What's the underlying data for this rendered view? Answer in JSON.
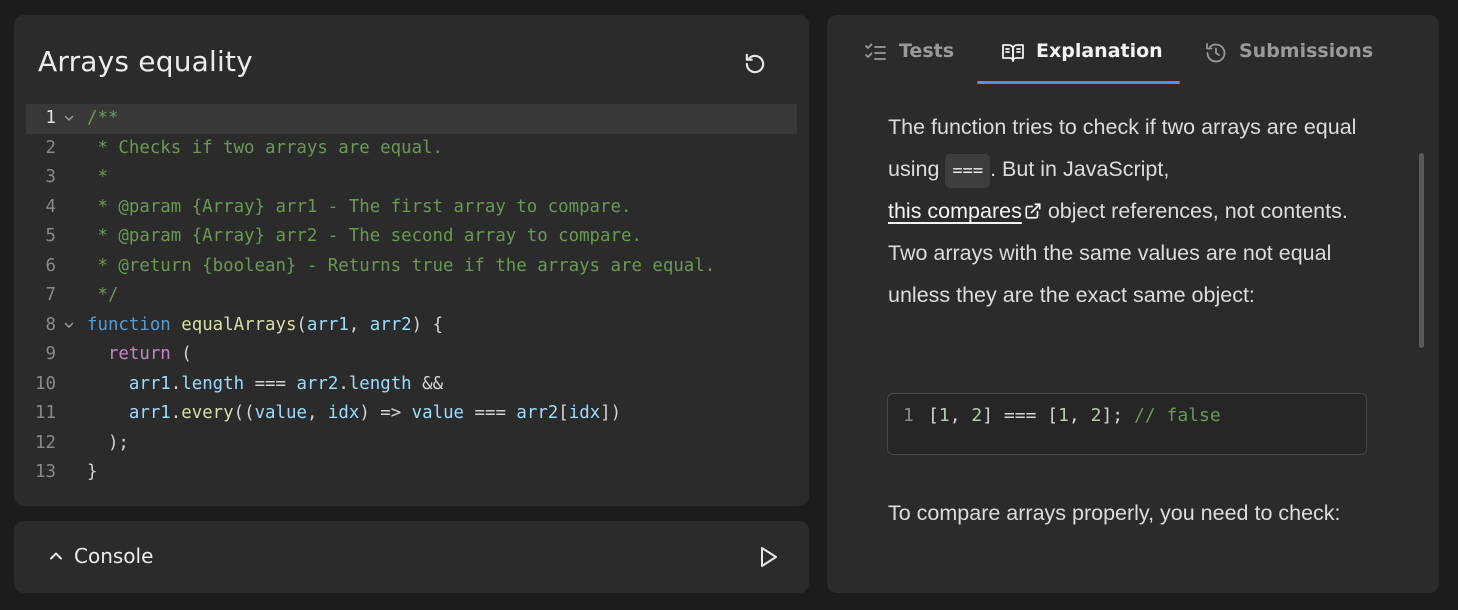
{
  "editor": {
    "title": "Arrays equality",
    "reset_icon": "reset-icon",
    "active_line": 1,
    "lines": [
      {
        "num": "1",
        "fold": true,
        "tokens": [
          [
            "c-com",
            "/**"
          ]
        ]
      },
      {
        "num": "2",
        "fold": false,
        "tokens": [
          [
            "c-com",
            " * Checks if two arrays are equal."
          ]
        ]
      },
      {
        "num": "3",
        "fold": false,
        "tokens": [
          [
            "c-com",
            " *"
          ]
        ]
      },
      {
        "num": "4",
        "fold": false,
        "tokens": [
          [
            "c-com",
            " * @param {Array} arr1 - The first array to compare."
          ]
        ]
      },
      {
        "num": "5",
        "fold": false,
        "tokens": [
          [
            "c-com",
            " * @param {Array} arr2 - The second array to compare."
          ]
        ]
      },
      {
        "num": "6",
        "fold": false,
        "tokens": [
          [
            "c-com",
            " * @return {boolean} - Returns true if the arrays are equal."
          ]
        ]
      },
      {
        "num": "7",
        "fold": false,
        "tokens": [
          [
            "c-com",
            " */"
          ]
        ]
      },
      {
        "num": "8",
        "fold": true,
        "tokens": [
          [
            "c-kw",
            "function"
          ],
          [
            "c-pun",
            " "
          ],
          [
            "c-fn",
            "equalArrays"
          ],
          [
            "c-pun",
            "("
          ],
          [
            "c-var",
            "arr1"
          ],
          [
            "c-pun",
            ", "
          ],
          [
            "c-var",
            "arr2"
          ],
          [
            "c-pun",
            ") {"
          ]
        ]
      },
      {
        "num": "9",
        "fold": false,
        "tokens": [
          [
            "c-pun",
            "  "
          ],
          [
            "c-ret",
            "return"
          ],
          [
            "c-pun",
            " ("
          ]
        ]
      },
      {
        "num": "10",
        "fold": false,
        "tokens": [
          [
            "c-pun",
            "    "
          ],
          [
            "c-var",
            "arr1"
          ],
          [
            "c-pun",
            "."
          ],
          [
            "c-var",
            "length"
          ],
          [
            "c-pun",
            " === "
          ],
          [
            "c-var",
            "arr2"
          ],
          [
            "c-pun",
            "."
          ],
          [
            "c-var",
            "length"
          ],
          [
            "c-pun",
            " &&"
          ]
        ]
      },
      {
        "num": "11",
        "fold": false,
        "tokens": [
          [
            "c-pun",
            "    "
          ],
          [
            "c-var",
            "arr1"
          ],
          [
            "c-pun",
            "."
          ],
          [
            "c-fn",
            "every"
          ],
          [
            "c-pun",
            "(("
          ],
          [
            "c-var",
            "value"
          ],
          [
            "c-pun",
            ", "
          ],
          [
            "c-var",
            "idx"
          ],
          [
            "c-pun",
            ") => "
          ],
          [
            "c-var",
            "value"
          ],
          [
            "c-pun",
            " === "
          ],
          [
            "c-var",
            "arr2"
          ],
          [
            "c-pun",
            "["
          ],
          [
            "c-var",
            "idx"
          ],
          [
            "c-pun",
            "])"
          ]
        ]
      },
      {
        "num": "12",
        "fold": false,
        "tokens": [
          [
            "c-pun",
            "  );"
          ]
        ]
      },
      {
        "num": "13",
        "fold": false,
        "tokens": [
          [
            "c-pun",
            "}"
          ]
        ]
      }
    ]
  },
  "console": {
    "label": "Console",
    "toggle_icon": "chevron-up-icon",
    "run_icon": "play-icon"
  },
  "tabs": [
    {
      "label": "Tests",
      "icon": "checklist-icon",
      "active": false
    },
    {
      "label": "Explanation",
      "icon": "book-icon",
      "active": true
    },
    {
      "label": "Submissions",
      "icon": "history-icon",
      "active": false
    }
  ],
  "explanation": {
    "p1_part1": "The function tries to check if two arrays are equal using ",
    "inline_code": "===",
    "p1_part2": ". But in JavaScript,",
    "link_text": "this compares",
    "p1_part3": " object references, not contents. Two arrays with the same values are not equal unless they are the exact same object:",
    "snippet": {
      "line_number": "1",
      "tokens": [
        [
          "c-pun",
          "["
        ],
        [
          "c-num",
          "1"
        ],
        [
          "c-pun",
          ", "
        ],
        [
          "c-num",
          "2"
        ],
        [
          "c-pun",
          "] === ["
        ],
        [
          "c-num",
          "1"
        ],
        [
          "c-pun",
          ", "
        ],
        [
          "c-num",
          "2"
        ],
        [
          "c-pun",
          "]; "
        ],
        [
          "c-com",
          "// false"
        ]
      ]
    },
    "p2": "To compare arrays properly, you need to check:"
  },
  "colors": {
    "background": "#1c1c1c",
    "panel": "#2b2b2b",
    "accent": "#4d8ef7",
    "comment": "#6a9955"
  }
}
